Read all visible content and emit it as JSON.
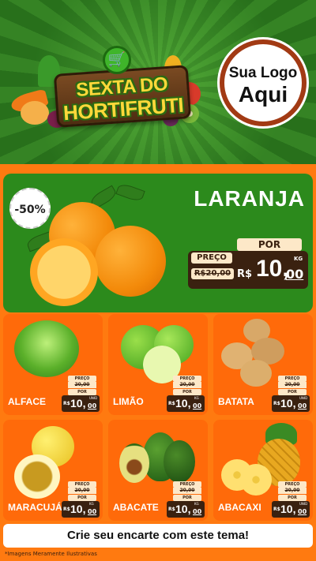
{
  "header": {
    "title_line1": "SEXTA DO",
    "title_line2": "HORTIFRUTI",
    "cart_icon": "shopping-cart-icon",
    "logo_line1": "Sua Logo",
    "logo_line2": "Aqui",
    "colors": {
      "green": "#2f8420",
      "wood": "#5a3416",
      "title_yellow": "#ffd83a",
      "logo_border": "#a23a14"
    }
  },
  "featured": {
    "badge": "-50%",
    "name": "LARANJA",
    "preco_label": "PREÇO",
    "old_price": "R$20,00",
    "por_label": "POR",
    "currency": "R$",
    "price_int": "10,",
    "price_cents": "00",
    "unit": "KG"
  },
  "products": [
    {
      "name": "ALFACE",
      "preco_label": "PREÇO",
      "old_price": "20,00",
      "por_label": "POR",
      "currency": "R$",
      "price_int": "10,",
      "price_cents": "00",
      "unit": "UNID"
    },
    {
      "name": "LIMÃO",
      "preco_label": "PREÇO",
      "old_price": "20,00",
      "por_label": "POR",
      "currency": "R$",
      "price_int": "10,",
      "price_cents": "00",
      "unit": "KG"
    },
    {
      "name": "BATATA",
      "preco_label": "PREÇO",
      "old_price": "20,00",
      "por_label": "POR",
      "currency": "R$",
      "price_int": "10,",
      "price_cents": "00",
      "unit": "UNID"
    },
    {
      "name": "MARACUJÁ",
      "preco_label": "PREÇO",
      "old_price": "20,00",
      "por_label": "POR",
      "currency": "R$",
      "price_int": "10,",
      "price_cents": "00",
      "unit": "KG"
    },
    {
      "name": "ABACATE",
      "preco_label": "PREÇO",
      "old_price": "20,00",
      "por_label": "POR",
      "currency": "R$",
      "price_int": "10,",
      "price_cents": "00",
      "unit": "KG"
    },
    {
      "name": "ABACAXI",
      "preco_label": "PREÇO",
      "old_price": "20,00",
      "por_label": "POR",
      "currency": "R$",
      "price_int": "10,",
      "price_cents": "00",
      "unit": "UNID"
    }
  ],
  "cta": "Crie seu encarte com este tema!",
  "disclaimer": "*Imagens Meramente Ilustrativas",
  "accent_orange": "#ff7a10",
  "price_dark": "#3a2110"
}
